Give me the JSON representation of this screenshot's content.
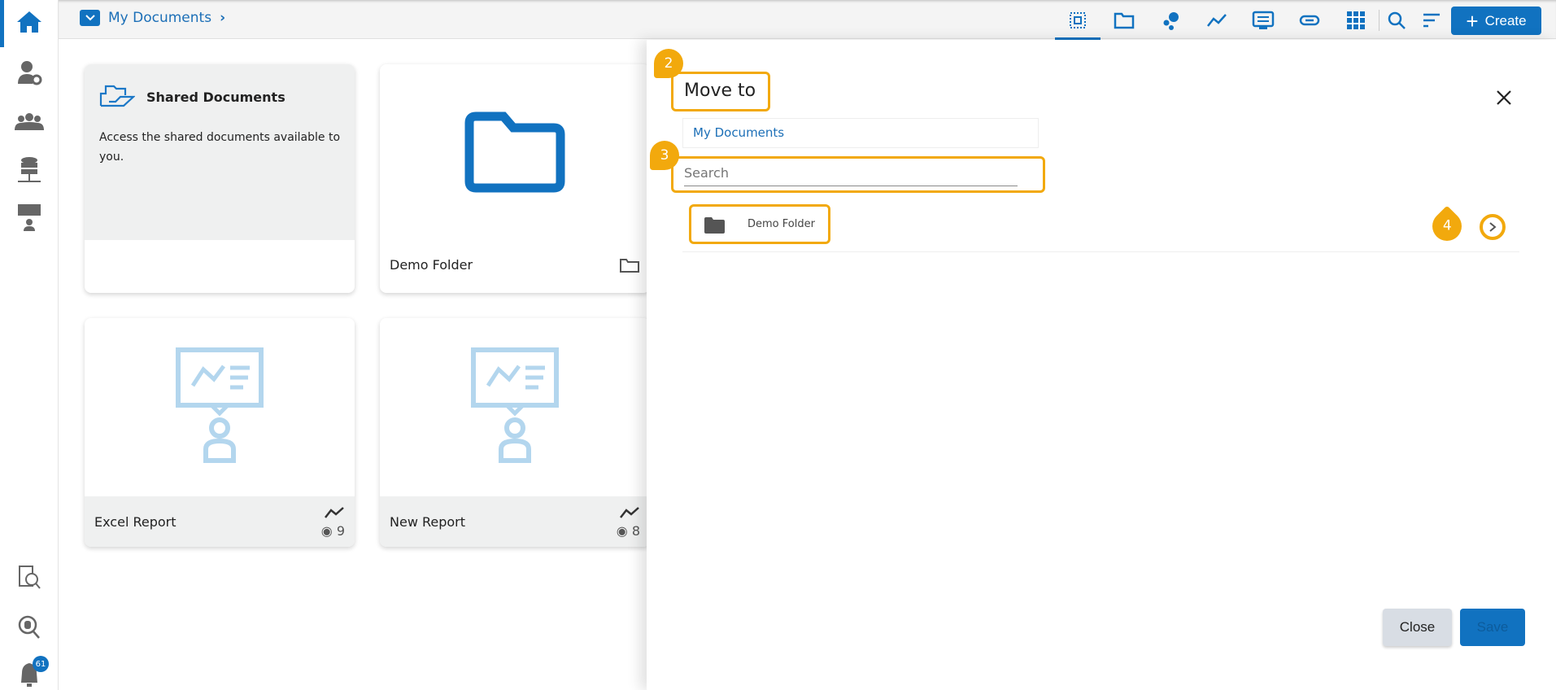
{
  "sidebar": {
    "items": [
      "home",
      "user-settings",
      "groups",
      "data-center",
      "data-science"
    ],
    "bottom": [
      "data-catalog",
      "data-search",
      "notifications"
    ],
    "notification_count": "61"
  },
  "topbar": {
    "breadcrumb": "My Documents",
    "create_label": "Create",
    "tools": [
      "select-all",
      "folder",
      "bubbles",
      "line-chart",
      "presentation",
      "link",
      "grid",
      "search",
      "sort"
    ]
  },
  "cards": [
    {
      "title": "Shared Documents",
      "description": "Access the shared documents available to you."
    },
    {
      "title": "Demo Folder"
    },
    {
      "title": "Excel Report",
      "views": "9"
    },
    {
      "title": "New Report",
      "views": "8"
    }
  ],
  "dialog": {
    "title": "Move to",
    "path": "My Documents",
    "search_placeholder": "Search",
    "folders": [
      {
        "name": "Demo Folder"
      }
    ],
    "close_label": "Close",
    "save_label": "Save"
  },
  "callouts": [
    "2",
    "3",
    "4"
  ],
  "colors": {
    "accent": "#1172c0",
    "highlight": "#f2a90d"
  }
}
